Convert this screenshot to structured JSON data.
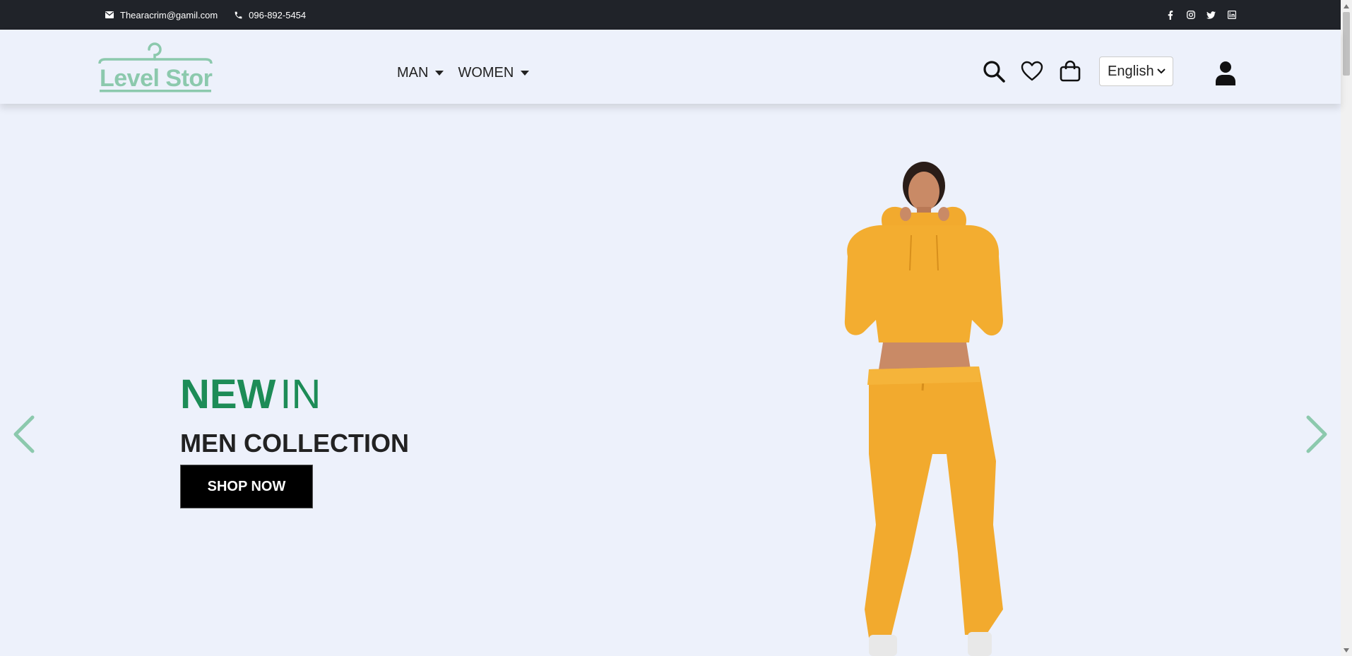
{
  "topbar": {
    "email": "Thearacrim@gamil.com",
    "phone": "096-892-5454",
    "social": [
      "facebook-icon",
      "instagram-icon",
      "twitter-icon",
      "linkedin-icon"
    ]
  },
  "navbar": {
    "logo_text": "Level Store",
    "menu": [
      {
        "label": "MAN"
      },
      {
        "label": "WOMEN"
      }
    ],
    "language": "English",
    "icons": [
      "search-icon",
      "heart-icon",
      "cart-icon",
      "user-icon"
    ]
  },
  "hero": {
    "headline_bold": "NEW",
    "headline_light": "IN",
    "subheadline": "MEN COLLECTION",
    "cta_label": "SHOP NOW"
  },
  "colors": {
    "topbar_bg": "#202329",
    "page_bg": "#edf1fb",
    "brand_green": "#1d8c57",
    "logo_green": "#8cc9ad",
    "outfit_yellow": "#f2aa2e"
  }
}
